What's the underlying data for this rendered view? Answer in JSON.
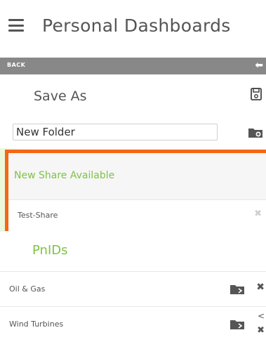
{
  "header": {
    "title": "Personal Dashboards"
  },
  "back_bar": {
    "label": "BACK"
  },
  "save_as": {
    "label": "Save As"
  },
  "new_folder": {
    "value": "New Folder"
  },
  "share": {
    "header": "New Share Available",
    "items": [
      {
        "label": "Test-Share"
      }
    ]
  },
  "pnids": {
    "label": "PnIDs",
    "items": [
      {
        "label": "Oil & Gas"
      },
      {
        "label": "Wind Turbines"
      }
    ]
  },
  "colors": {
    "highlight_border": "#f46713",
    "accent_green": "#7dc443",
    "back_bar": "#888888"
  }
}
